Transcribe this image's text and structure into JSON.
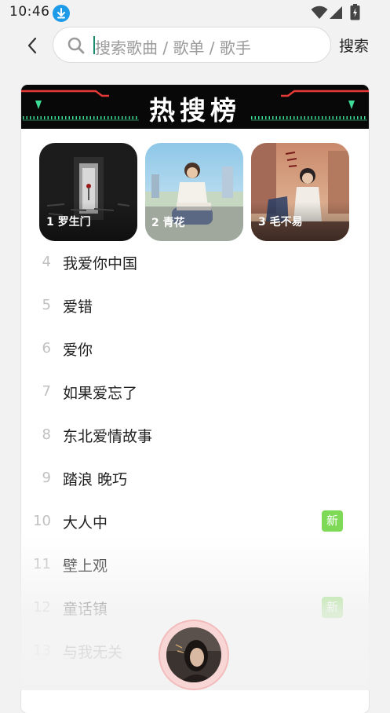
{
  "status": {
    "time": "10:46",
    "icons": [
      "download-icon",
      "wifi-icon",
      "signal-icon",
      "battery-icon"
    ]
  },
  "search": {
    "placeholder": "搜索歌曲 / 歌单 / 歌手",
    "submit_label": "搜索"
  },
  "hot": {
    "title": "热搜榜",
    "top": [
      {
        "label": "1 罗生门"
      },
      {
        "label": "2 青花"
      },
      {
        "label": "3 毛不易"
      }
    ],
    "list": [
      {
        "rank": "4",
        "title": "我爱你中国",
        "badge": ""
      },
      {
        "rank": "5",
        "title": "爱错",
        "badge": ""
      },
      {
        "rank": "6",
        "title": "爱你",
        "badge": ""
      },
      {
        "rank": "7",
        "title": "如果爱忘了",
        "badge": ""
      },
      {
        "rank": "8",
        "title": "东北爱情故事",
        "badge": ""
      },
      {
        "rank": "9",
        "title": "踏浪 晚巧",
        "badge": ""
      },
      {
        "rank": "10",
        "title": "大人中",
        "badge": "新"
      },
      {
        "rank": "11",
        "title": "壁上观",
        "badge": ""
      },
      {
        "rank": "12",
        "title": "童话镇",
        "badge": "新"
      },
      {
        "rank": "13",
        "title": "与我无关",
        "badge": ""
      }
    ]
  },
  "colors": {
    "accent": "#1a8a6e",
    "banner_bg": "#080808",
    "banner_red": "#e53935",
    "new_badge": "#7ed957"
  }
}
